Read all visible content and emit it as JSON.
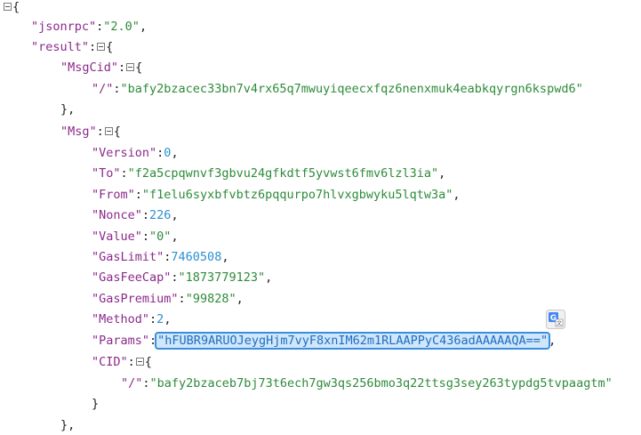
{
  "json": {
    "k_jsonrpc": "\"jsonrpc\"",
    "v_jsonrpc": "\"2.0\"",
    "k_result": "\"result\"",
    "k_msgcid": "\"MsgCid\"",
    "k_slash": "\"/\"",
    "v_msgcid": "\"bafy2bzacec33bn7v4rx65q7mwuyiqeecxfqz6nenxmuk4eabkqyrgn6kspwd6\"",
    "k_msg": "\"Msg\"",
    "k_version": "\"Version\"",
    "v_version": "0",
    "k_to": "\"To\"",
    "v_to": "\"f2a5cpqwnvf3gbvu24gfkdtf5yvwst6fmv6lzl3ia\"",
    "k_from": "\"From\"",
    "v_from": "\"f1elu6syxbfvbtz6pqqurpo7hlvxgbwyku5lqtw3a\"",
    "k_nonce": "\"Nonce\"",
    "v_nonce": "226",
    "k_value": "\"Value\"",
    "v_value": "\"0\"",
    "k_gaslimit": "\"GasLimit\"",
    "v_gaslimit": "7460508",
    "k_gasfeecap": "\"GasFeeCap\"",
    "v_gasfeecap": "\"1873779123\"",
    "k_gaspremium": "\"GasPremium\"",
    "v_gaspremium": "\"99828\"",
    "k_method": "\"Method\"",
    "v_method": "2",
    "k_params": "\"Params\"",
    "v_params": "\"hFUBR9ARUOJeygHjm7vyF8xnIM62m1RLAAPPyC436adAAAAAQA==\"",
    "k_cid": "\"CID\"",
    "v_cid": "\"bafy2bzaceb7bj73t6ech7gw3qs256bmo3q22ttsg3sey263typdg5tvpaagtm\""
  },
  "punct": {
    "open": "{",
    "close": "}",
    "close_comma": "},",
    "colon": ":",
    "comma": ","
  },
  "icons": {
    "collapse": "collapse-toggle-icon",
    "translate": "translate-icon"
  }
}
